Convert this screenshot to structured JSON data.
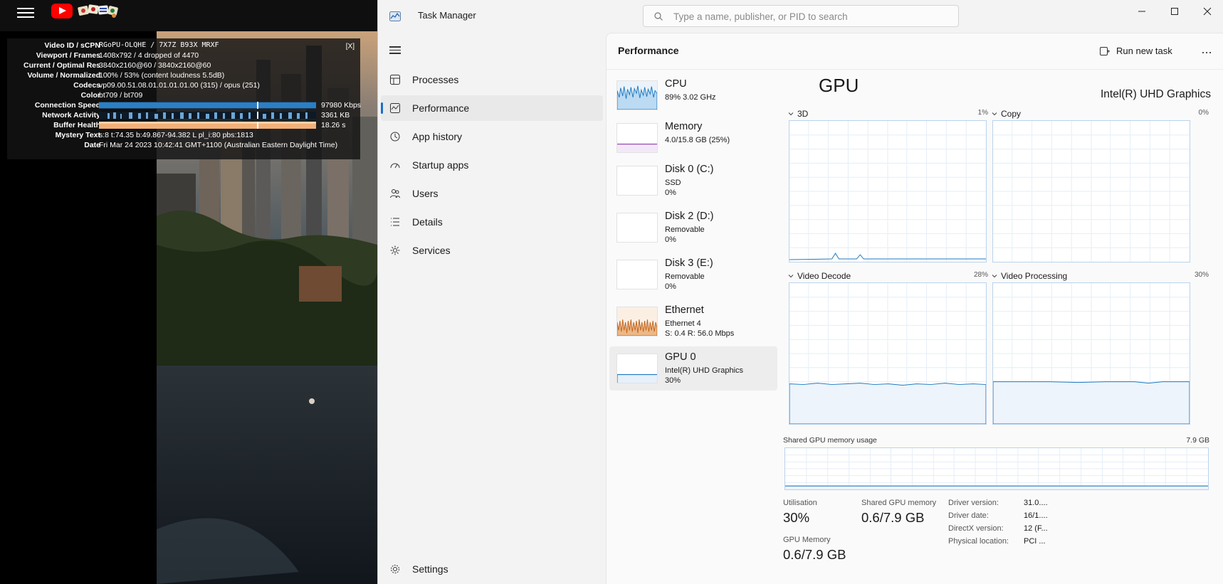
{
  "youtube": {
    "stats": {
      "close_label": "[X]",
      "rows": [
        {
          "label": "Video ID / sCPN",
          "value": "RGoPU-OLQHE  /  7X7Z  B93X  MRXF"
        },
        {
          "label": "Viewport / Frames",
          "value": "1408x792 / 4 dropped of 4470"
        },
        {
          "label": "Current / Optimal Res",
          "value": "3840x2160@60 / 3840x2160@60"
        },
        {
          "label": "Volume / Normalized",
          "value": "100% / 53% (content loudness 5.5dB)"
        },
        {
          "label": "Codecs",
          "value": "vp09.00.51.08.01.01.01.01.00 (315) / opus (251)"
        },
        {
          "label": "Color",
          "value": "bt709 / bt709"
        },
        {
          "label": "Connection Speed",
          "value": "97980 Kbps"
        },
        {
          "label": "Network Activity",
          "value": "3361 KB"
        },
        {
          "label": "Buffer Health",
          "value": "18.26 s"
        },
        {
          "label": "Mystery Text",
          "value": "s:8 t:74.35 b:49.867-94.382 L pl_i:80 pbs:1813"
        },
        {
          "label": "Date",
          "value": "Fri Mar 24 2023 10:42:41 GMT+1100 (Australian Eastern Daylight Time)"
        }
      ]
    }
  },
  "task_manager": {
    "title": "Task Manager",
    "search_placeholder": "Type a name, publisher, or PID to search",
    "nav": [
      {
        "label": "Processes",
        "icon": "processes-icon"
      },
      {
        "label": "Performance",
        "icon": "performance-icon",
        "active": true
      },
      {
        "label": "App history",
        "icon": "app-history-icon"
      },
      {
        "label": "Startup apps",
        "icon": "startup-icon"
      },
      {
        "label": "Users",
        "icon": "users-icon"
      },
      {
        "label": "Details",
        "icon": "details-icon"
      },
      {
        "label": "Services",
        "icon": "services-icon"
      }
    ],
    "settings_label": "Settings",
    "page_title": "Performance",
    "run_new_task": "Run new task",
    "more": "...",
    "devices": [
      {
        "name": "CPU",
        "sub1": "89%  3.02 GHz",
        "sub2": ""
      },
      {
        "name": "Memory",
        "sub1": "4.0/15.8 GB (25%)",
        "sub2": ""
      },
      {
        "name": "Disk 0 (C:)",
        "sub1": "SSD",
        "sub2": "0%"
      },
      {
        "name": "Disk 2 (D:)",
        "sub1": "Removable",
        "sub2": "0%"
      },
      {
        "name": "Disk 3 (E:)",
        "sub1": "Removable",
        "sub2": "0%"
      },
      {
        "name": "Ethernet",
        "sub1": "Ethernet 4",
        "sub2": "S: 0.4  R: 56.0 Mbps"
      },
      {
        "name": "GPU 0",
        "sub1": "Intel(R) UHD Graphics",
        "sub2": "30%",
        "active": true
      }
    ],
    "gpu": {
      "title": "GPU",
      "model": "Intel(R) UHD Graphics",
      "engines": [
        {
          "name": "3D",
          "percent": "1%",
          "level": 0.01
        },
        {
          "name": "Copy",
          "percent": "0%",
          "level": 0.0
        },
        {
          "name": "Video Decode",
          "percent": "28%",
          "level": 0.28
        },
        {
          "name": "Video Processing",
          "percent": "30%",
          "level": 0.3
        }
      ],
      "shared_label": "Shared GPU memory usage",
      "shared_max": "7.9 GB",
      "stats": {
        "utilisation_label": "Utilisation",
        "utilisation_value": "30%",
        "shared_mem_label": "Shared GPU memory",
        "shared_mem_value": "0.6/7.9 GB",
        "gpu_mem_label": "GPU Memory",
        "gpu_mem_value": "0.6/7.9 GB"
      },
      "details": [
        {
          "key": "Driver version:",
          "value": "31.0...."
        },
        {
          "key": "Driver date:",
          "value": "16/1...."
        },
        {
          "key": "DirectX version:",
          "value": "12 (F..."
        },
        {
          "key": "Physical location:",
          "value": "PCI ..."
        }
      ]
    }
  }
}
